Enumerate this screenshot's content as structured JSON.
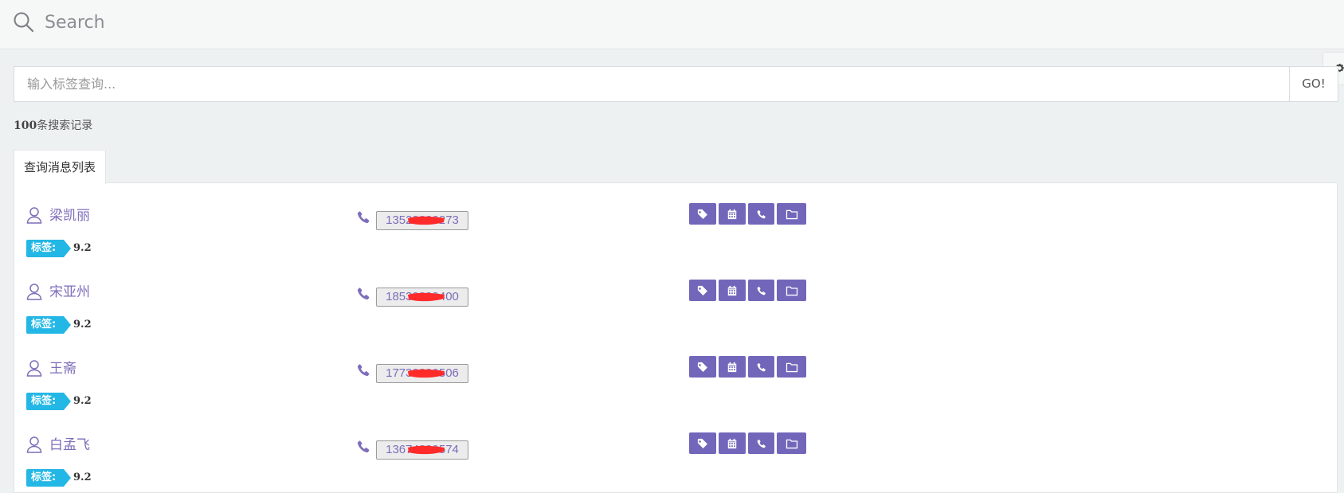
{
  "topbar": {
    "search_label": "Search"
  },
  "search_bar": {
    "placeholder": "输入标签查询...",
    "go_label": "GO!"
  },
  "results": {
    "count": "100",
    "count_suffix": "条搜索记录"
  },
  "tabs": [
    {
      "label": "查询消息列表"
    }
  ],
  "contacts": [
    {
      "name": "梁凯丽",
      "tag_label": "标签:",
      "tag_value": "9.2",
      "phone": "13529990273"
    },
    {
      "name": "宋亚州",
      "tag_label": "标签:",
      "tag_value": "9.2",
      "phone": "18539999400"
    },
    {
      "name": "王斋",
      "tag_label": "标签:",
      "tag_value": "9.2",
      "phone": "17739990506"
    },
    {
      "name": "白孟飞",
      "tag_label": "标签:",
      "tag_value": "9.2",
      "phone": "13674999574"
    }
  ],
  "actions": [
    {
      "icon": "tag-icon"
    },
    {
      "icon": "calendar-icon"
    },
    {
      "icon": "phone-icon"
    },
    {
      "icon": "folder-icon"
    }
  ],
  "colors": {
    "accent": "#7266ba",
    "link": "#7e6db9",
    "tag_badge": "#23b7e5",
    "redaction": "#ff2b2b"
  }
}
